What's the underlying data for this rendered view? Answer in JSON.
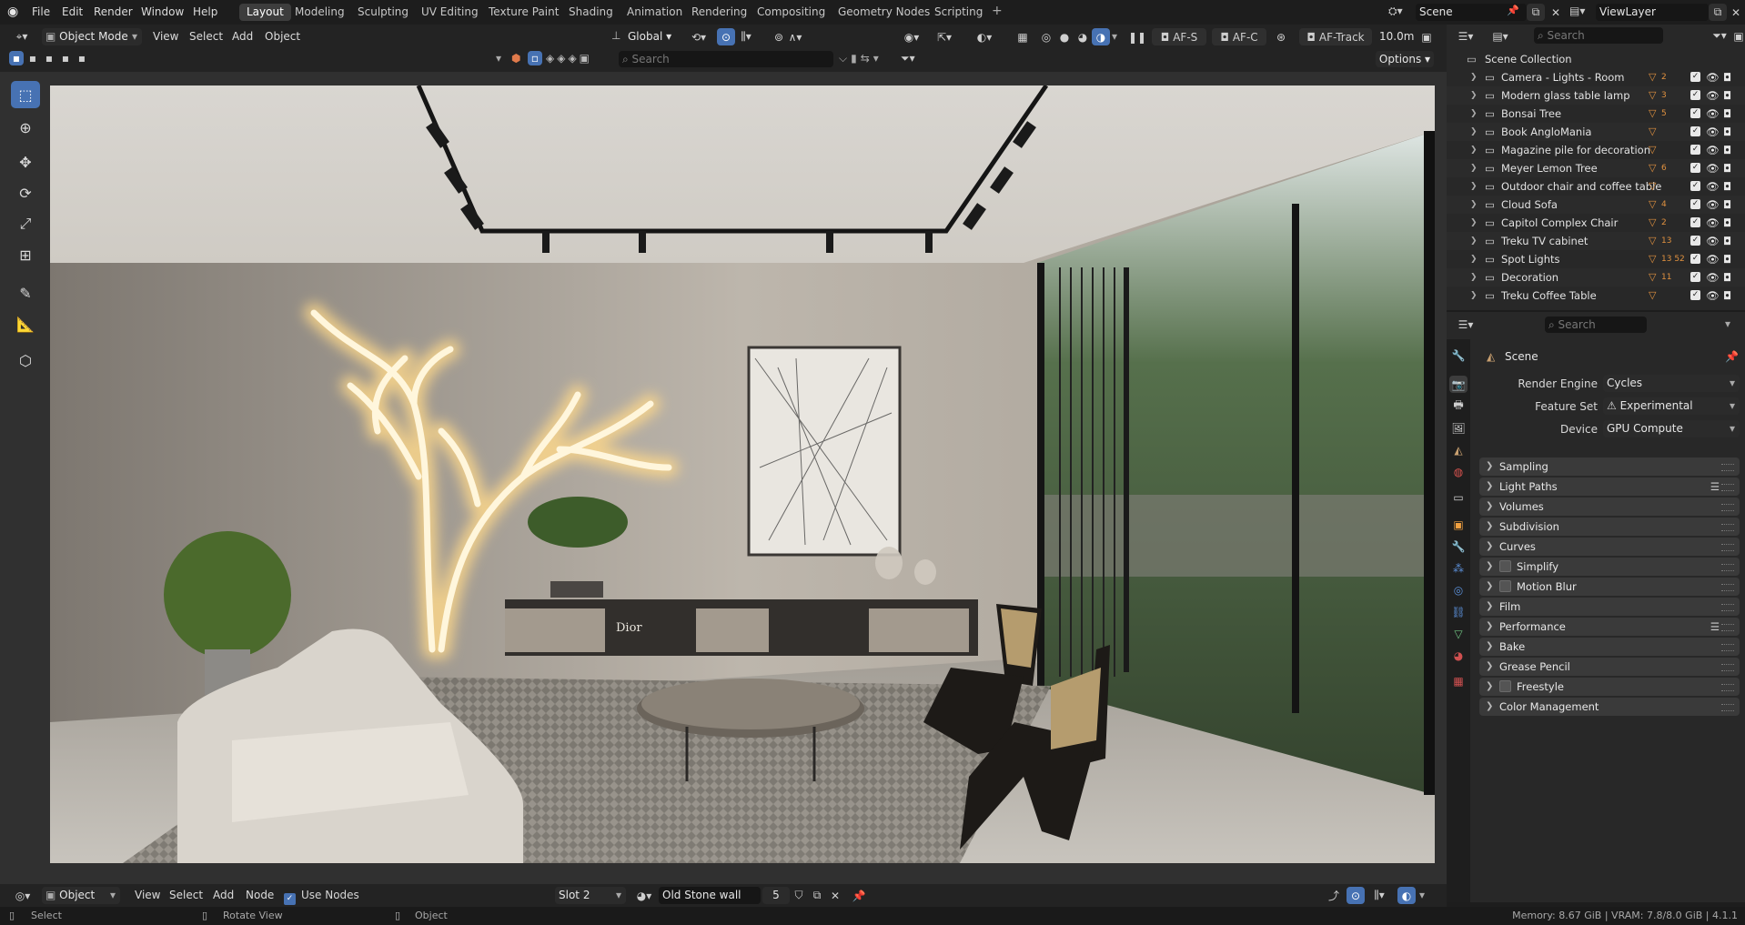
{
  "menubar": {
    "items": [
      "File",
      "Edit",
      "Render",
      "Window",
      "Help"
    ],
    "workspaces": [
      "Layout",
      "Modeling",
      "Sculpting",
      "UV Editing",
      "Texture Paint",
      "Shading",
      "Animation",
      "Rendering",
      "Compositing",
      "Geometry Nodes",
      "Scripting"
    ],
    "active_workspace": "Layout",
    "scene_name": "Scene",
    "view_layer": "ViewLayer"
  },
  "viewport_header": {
    "mode": "Object Mode",
    "menu": [
      "View",
      "Select",
      "Add",
      "Object"
    ],
    "orientation": "Global",
    "af_s": "AF-S",
    "af_c": "AF-C",
    "af_track": "AF-Track",
    "distance": "10.0m",
    "search_placeholder": "Search",
    "options_label": "Options"
  },
  "outliner": {
    "search_placeholder": "Search",
    "root": "Scene Collection",
    "collections": [
      "Camera - Lights - Room",
      "Modern glass table lamp",
      "Bonsai Tree",
      "Book AngloMania",
      "Magazine pile for decoration",
      "Meyer Lemon Tree",
      "Outdoor chair and coffee table",
      "Cloud Sofa",
      "Capitol Complex Chair",
      "Treku TV cabinet",
      "Spot Lights",
      "Decoration",
      "Treku Coffee Table"
    ],
    "badges": [
      "2",
      "3",
      "5",
      "",
      "",
      "6",
      "",
      "4",
      "2",
      "13",
      "13 52",
      "11",
      ""
    ]
  },
  "properties": {
    "search_placeholder": "Search",
    "context": "Scene",
    "render_engine_label": "Render Engine",
    "render_engine": "Cycles",
    "feature_set_label": "Feature Set",
    "feature_set": "Experimental",
    "device_label": "Device",
    "device": "GPU Compute",
    "panels": [
      "Sampling",
      "Light Paths",
      "Volumes",
      "Subdivision",
      "Curves",
      "Simplify",
      "Motion Blur",
      "Film",
      "Performance",
      "Bake",
      "Grease Pencil",
      "Freestyle",
      "Color Management"
    ]
  },
  "bottom_header": {
    "mode": "Object",
    "menu": [
      "View",
      "Select",
      "Add",
      "Node"
    ],
    "use_nodes": "Use Nodes",
    "slot": "Slot 2",
    "material": "Old Stone wall",
    "users": "5"
  },
  "statusbar": {
    "left": [
      "Select",
      "Rotate View",
      "Object"
    ],
    "right": "Memory: 8.67 GiB | VRAM: 7.8/8.0 GiB | 4.1.1"
  },
  "render_art": {
    "book_text": "Dior"
  },
  "colors": {
    "accent": "#4772b3",
    "panel": "#3a3a3a",
    "background": "#1d1d1d",
    "orange": "#e0913f"
  }
}
